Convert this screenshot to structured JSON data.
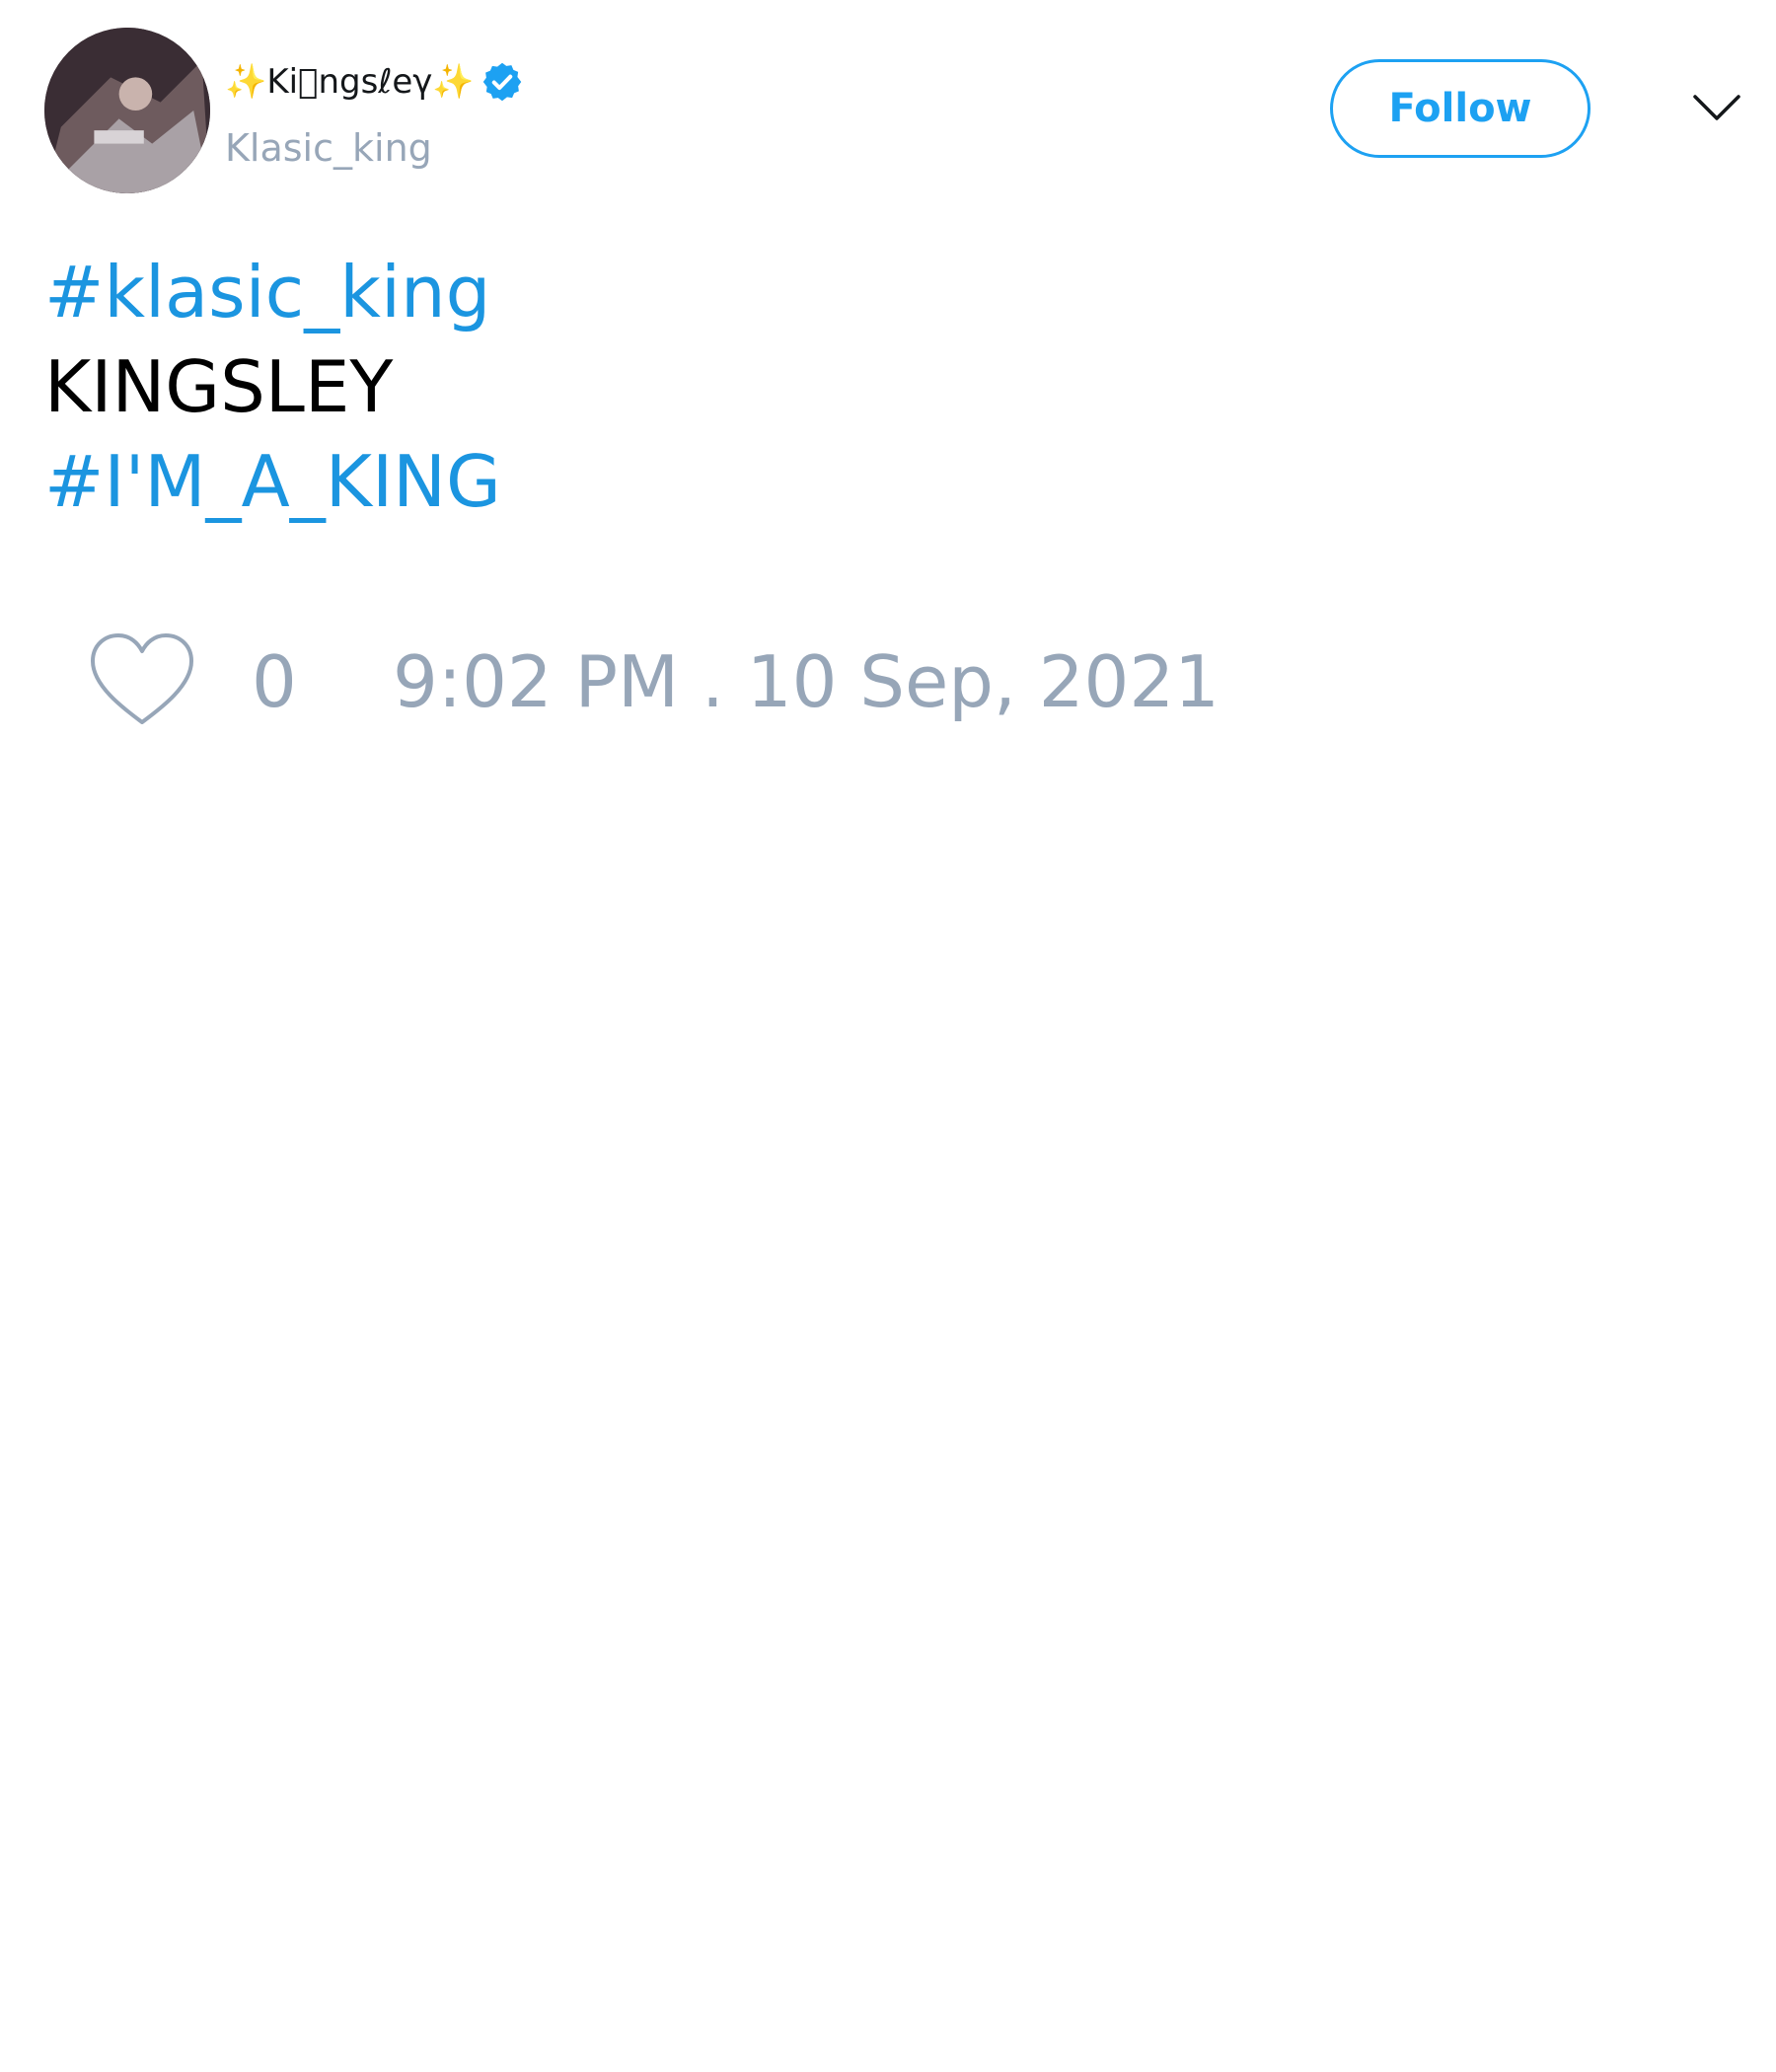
{
  "author": {
    "display_name": "✨Kiᷝngꜱℓeγ✨",
    "handle": "Klasic_king",
    "verified": true,
    "avatar_icon": "avatar-photo"
  },
  "actions": {
    "follow_label": "Follow",
    "menu_icon": "chevron-down-icon"
  },
  "tweet": {
    "lines": [
      {
        "text": "#klasic_king",
        "type": "hashtag"
      },
      {
        "text": "KINGSLEY",
        "type": "text"
      },
      {
        "text": "#I'M_A_KING",
        "type": "hashtag"
      }
    ]
  },
  "footer": {
    "like_icon": "heart-icon",
    "like_count": "0",
    "timestamp": "9:02 PM . 10 Sep, 2021"
  },
  "colors": {
    "accent": "#1da1f2",
    "hashtag": "#1b95e0",
    "muted": "#97a6b8",
    "text": "#000000"
  }
}
